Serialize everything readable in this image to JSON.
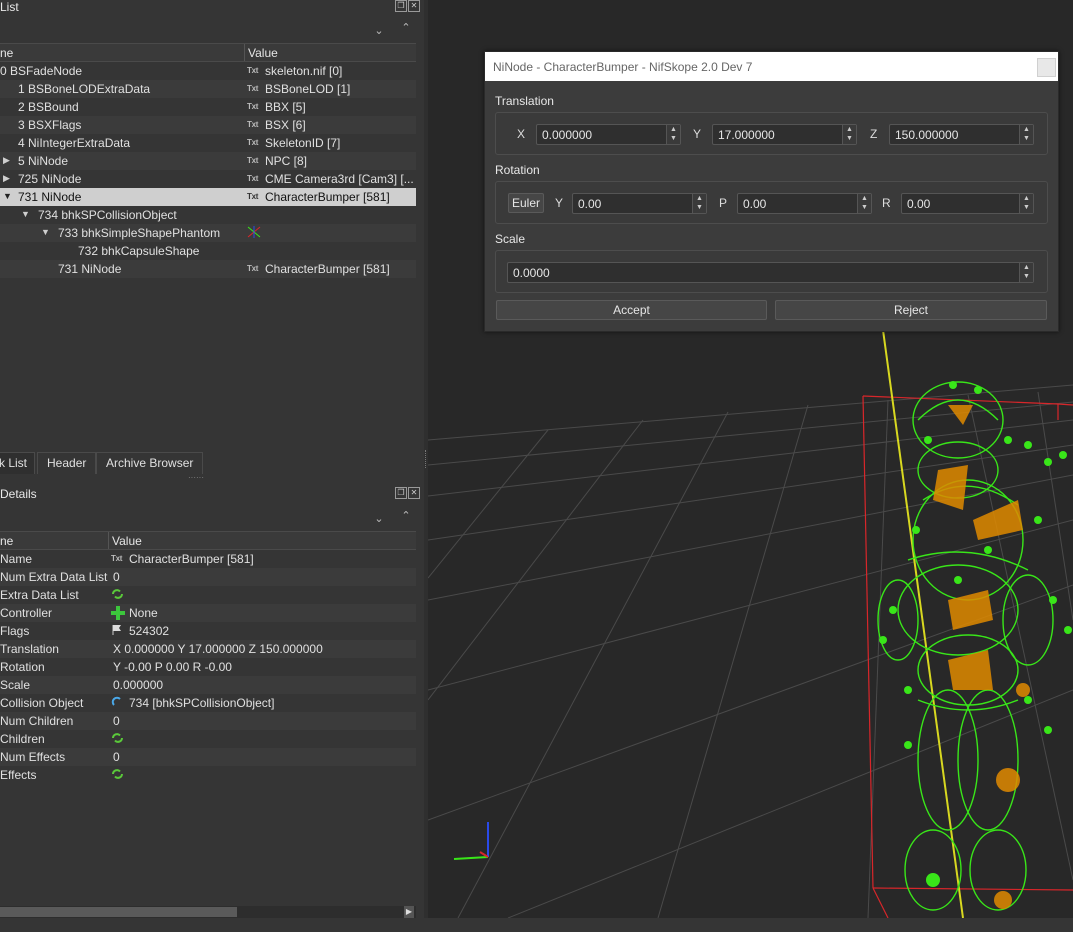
{
  "block_list": {
    "title": "List",
    "columns": [
      "ne",
      "Value"
    ],
    "rows": [
      {
        "name": "0 BSFadeNode",
        "value": "skeleton.nif [0]",
        "icon": "txt"
      },
      {
        "name": "1 BSBoneLODExtraData",
        "value": "BSBoneLOD [1]",
        "icon": "txt"
      },
      {
        "name": "2 BSBound",
        "value": "BBX [5]",
        "icon": "txt"
      },
      {
        "name": "3 BSXFlags",
        "value": "BSX [6]",
        "icon": "txt"
      },
      {
        "name": "4 NiIntegerExtraData",
        "value": "SkeletonID [7]",
        "icon": "txt"
      },
      {
        "name": "5 NiNode",
        "value": "NPC [8]",
        "icon": "txt"
      },
      {
        "name": "725 NiNode",
        "value": "CME Camera3rd [Cam3] [...",
        "icon": "txt"
      },
      {
        "name": "731 NiNode",
        "value": "CharacterBumper [581]",
        "icon": "txt"
      },
      {
        "name": "734 bhkSPCollisionObject",
        "value": "",
        "icon": ""
      },
      {
        "name": "733 bhkSimpleShapePhantom",
        "value": "",
        "icon": "axes"
      },
      {
        "name": "732 bhkCapsuleShape",
        "value": "",
        "icon": ""
      },
      {
        "name": "731 NiNode",
        "value": "CharacterBumper [581]",
        "icon": "txt"
      }
    ],
    "txt_icon": "Txt"
  },
  "tabs": [
    "k List",
    "Header",
    "Archive Browser"
  ],
  "block_details": {
    "title": "Details",
    "columns": [
      "ne",
      "Value"
    ],
    "rows": [
      {
        "name": "Name",
        "value": "CharacterBumper [581]",
        "icon": "txt"
      },
      {
        "name": "Num Extra Data List",
        "value": "0",
        "icon": ""
      },
      {
        "name": "Extra Data List",
        "value": "",
        "icon": "refresh"
      },
      {
        "name": "Controller",
        "value": "None",
        "icon": "plus"
      },
      {
        "name": "Flags",
        "value": "524302",
        "icon": "flag"
      },
      {
        "name": "Translation",
        "value": "X 0.000000 Y 17.000000 Z 150.000000",
        "icon": ""
      },
      {
        "name": "Rotation",
        "value": "Y -0.00 P 0.00 R -0.00",
        "icon": ""
      },
      {
        "name": "Scale",
        "value": "0.000000",
        "icon": ""
      },
      {
        "name": "Collision Object",
        "value": "734 [bhkSPCollisionObject]",
        "icon": "link"
      },
      {
        "name": "Num Children",
        "value": "0",
        "icon": ""
      },
      {
        "name": "Children",
        "value": "",
        "icon": "refresh"
      },
      {
        "name": "Num Effects",
        "value": "0",
        "icon": ""
      },
      {
        "name": "Effects",
        "value": "",
        "icon": "refresh"
      }
    ]
  },
  "dialog": {
    "title": "NiNode - CharacterBumper - NifSkope 2.0 Dev 7",
    "translation_label": "Translation",
    "x_label": "X",
    "x_value": "0.000000",
    "y_label": "Y",
    "y_value": "17.000000",
    "z_label": "Z",
    "z_value": "150.000000",
    "rotation_label": "Rotation",
    "euler_label": "Euler",
    "ry_label": "Y",
    "ry_value": "0.00",
    "rp_label": "P",
    "rp_value": "0.00",
    "rr_label": "R",
    "rr_value": "0.00",
    "scale_label": "Scale",
    "scale_value": "0.0000",
    "accept_label": "Accept",
    "reject_label": "Reject"
  },
  "colors": {
    "accent_selection": "#cfcfcf",
    "bbox_red": "#d8262a",
    "mesh_green": "#39e619",
    "bone_orange": "#e08a00",
    "axis_yellow": "#d8d820"
  }
}
